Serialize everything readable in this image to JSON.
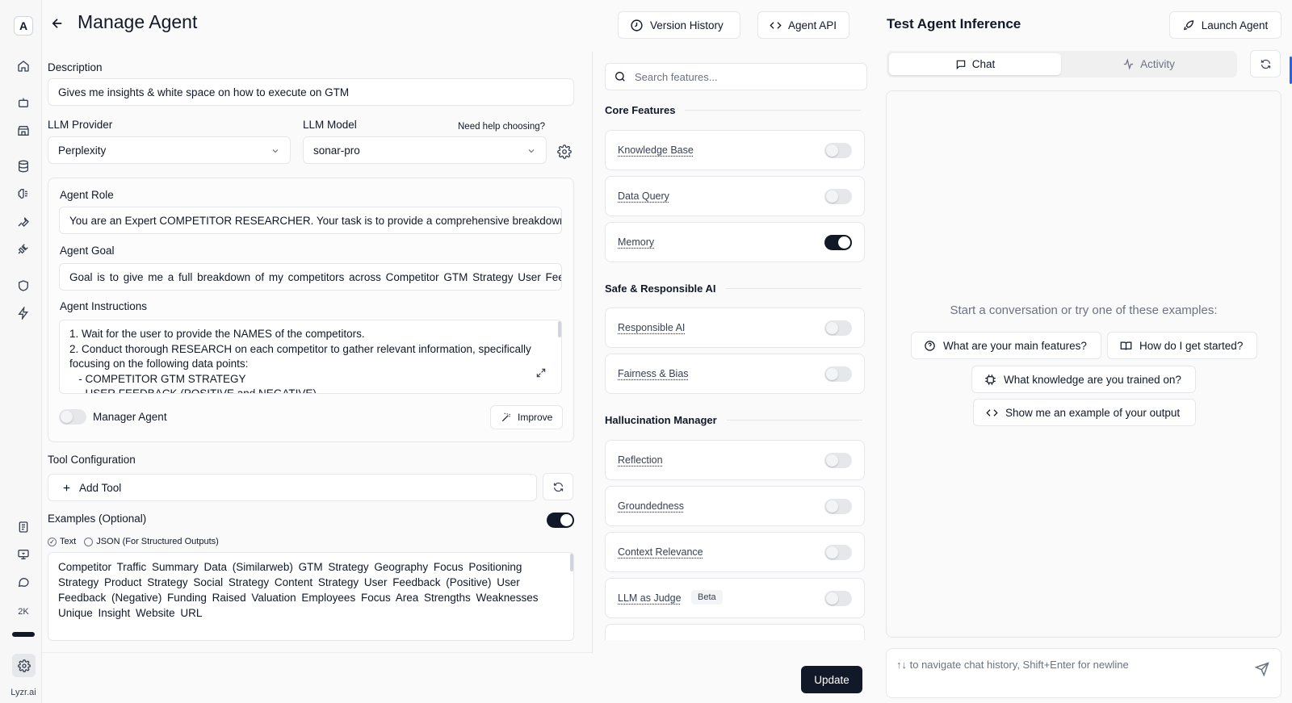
{
  "rail": {
    "logo": "A",
    "count": "2K",
    "brand": "Lyzr.ai"
  },
  "header": {
    "title": "Manage Agent",
    "version_history": "Version History",
    "agent_api": "Agent API"
  },
  "form": {
    "description_label": "Description",
    "description_value": "Gives me insights & white space on how to execute on GTM",
    "llm_provider_label": "LLM Provider",
    "llm_provider_value": "Perplexity",
    "llm_model_label": "LLM Model",
    "llm_model_value": "sonar-pro",
    "help_link": "Need help choosing?",
    "agent_role_label": "Agent Role",
    "agent_role_value": "You are an Expert COMPETITOR RESEARCHER. Your task is to provide a comprehensive breakdown of",
    "agent_goal_label": "Agent Goal",
    "agent_goal_value": "Goal is to give me a full breakdown of my competitors across Competitor GTM Strategy   User Feedback",
    "agent_instructions_label": "Agent Instructions",
    "instructions": {
      "line1": "1. Wait for the user to provide the NAMES of the competitors.",
      "line2": "2. Conduct thorough RESEARCH on each competitor to gather relevant information, specifically focusing on the following data points:",
      "line3": "   - COMPETITOR GTM STRATEGY",
      "line4": "   - USER FEEDBACK (POSITIVE and NEGATIVE)"
    },
    "manager_agent_label": "Manager Agent",
    "improve_label": "Improve",
    "tool_config_label": "Tool Configuration",
    "add_tool_label": "Add Tool",
    "examples_label": "Examples (Optional)",
    "radio_text": "Text",
    "radio_json": "JSON (For Structured Outputs)",
    "examples_value": "Competitor  Traffic Summary Data (Similarweb)  GTM Strategy  Geography Focus Positioning Strategy Product Strategy Social Strategy Content Strategy User Feedback (Positive) User Feedback (Negative) Funding Raised Valuation  Employees Focus Area Strengths  Weaknesses Unique Insight Website URL",
    "update_label": "Update"
  },
  "features": {
    "search_placeholder": "Search features...",
    "core_heading": "Core Features",
    "knowledge_base": "Knowledge Base",
    "data_query": "Data Query",
    "memory": "Memory",
    "safe_heading": "Safe & Responsible AI",
    "responsible_ai": "Responsible AI",
    "fairness_bias": "Fairness & Bias",
    "hallucination_heading": "Hallucination Manager",
    "reflection": "Reflection",
    "groundedness": "Groundedness",
    "context_relevance": "Context Relevance",
    "llm_judge": "LLM as Judge",
    "beta": "Beta"
  },
  "test": {
    "title": "Test Agent Inference",
    "launch_label": "Launch Agent",
    "tab_chat": "Chat",
    "tab_activity": "Activity",
    "prompt": "Start a conversation or try one of these examples:",
    "s1": "What are your main features?",
    "s2": "How do I get started?",
    "s3": "What knowledge are you trained on?",
    "s4": "Show me an example of your output",
    "input_placeholder": "↑↓ to navigate chat history, Shift+Enter for newline"
  },
  "colors": {
    "primary": "#111827",
    "border": "#e5e7eb",
    "muted": "#6b7280",
    "accent_edge": "#2563eb"
  }
}
